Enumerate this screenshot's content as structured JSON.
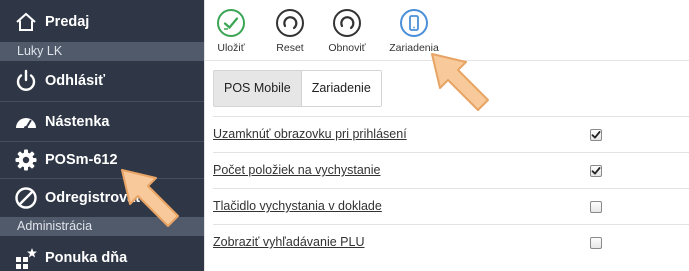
{
  "sidebar": {
    "top_item": {
      "label": "Predaj",
      "icon": "home-icon"
    },
    "user_section": "Luky LK",
    "user_items": [
      {
        "label": "Odhlásiť",
        "icon": "power-icon"
      },
      {
        "label": "Nástenka",
        "icon": "dashboard-icon"
      },
      {
        "label": "POSm-612",
        "icon": "gear-icon"
      },
      {
        "label": "Odregistrovať",
        "icon": "ban-icon"
      }
    ],
    "admin_section": "Administrácia",
    "admin_items": [
      {
        "label": "Ponuka dňa",
        "icon": "grid-star-icon"
      }
    ]
  },
  "toolbar": {
    "buttons": [
      {
        "label": "Uložiť",
        "icon": "save-check-icon",
        "color": "#3aa655"
      },
      {
        "label": "Reset",
        "icon": "reset-circle-icon",
        "color": "#333333"
      },
      {
        "label": "Obnoviť",
        "icon": "refresh-circle-icon",
        "color": "#333333"
      },
      {
        "label": "Zariadenia",
        "icon": "mobile-device-icon",
        "color": "#4a90d9"
      }
    ]
  },
  "tabs": [
    {
      "label": "POS Mobile",
      "active": true
    },
    {
      "label": "Zariadenie",
      "active": false
    }
  ],
  "settings": [
    {
      "label": "Uzamknúť obrazovku pri prihlásení",
      "checked": true
    },
    {
      "label": "Počet položiek na vychystanie",
      "checked": true
    },
    {
      "label": "Tlačidlo vychystania v doklade",
      "checked": false
    },
    {
      "label": "Zobraziť vyhľadávanie PLU",
      "checked": false
    }
  ],
  "colors": {
    "sidebar_bg": "#2f3746",
    "section_bg": "#515a6b",
    "arrow_fill": "#f8c99a",
    "arrow_stroke": "#e8a465"
  }
}
